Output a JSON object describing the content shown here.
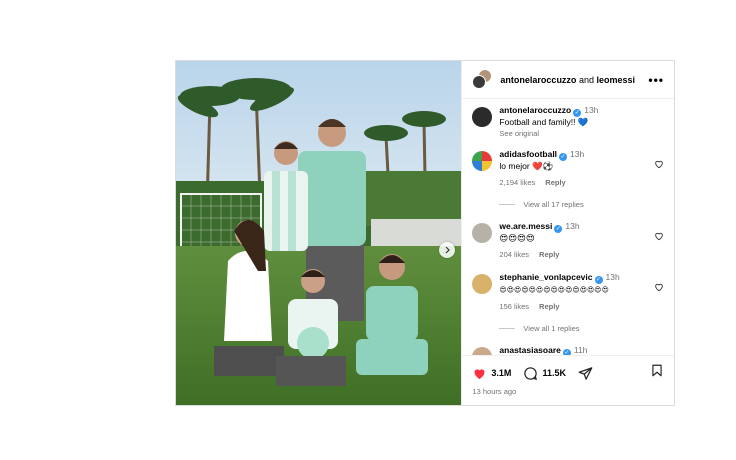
{
  "header": {
    "user1": "antonelaroccuzzo",
    "conj": "and",
    "user2": "leomessi"
  },
  "caption": {
    "username": "antonelaroccuzzo",
    "time": "13h",
    "text": "Football and family!! 💙",
    "see_original": "See original"
  },
  "comments": [
    {
      "username": "adidasfootball",
      "time": "13h",
      "text": "lo mejor ❤️⚽",
      "likes": "2,194 likes",
      "reply": "Reply",
      "view_replies": "View all 17 replies"
    },
    {
      "username": "we.are.messi",
      "time": "13h",
      "text": "😍😍😍😍",
      "likes": "204 likes",
      "reply": "Reply"
    },
    {
      "username": "stephanie_vonlapcevic",
      "time": "13h",
      "text": "😍😍😍😍😍😍😍😍😍😍😍😍😍😍😍",
      "likes": "156 likes",
      "reply": "Reply",
      "view_replies": "View all 1 replies"
    },
    {
      "username": "anastasiasoare",
      "time": "11h"
    }
  ],
  "footer": {
    "likes_count": "3.1M",
    "comments_count": "11.5K",
    "posted_ago": "13 hours ago"
  },
  "colors": {
    "verified": "#3797f0",
    "like_red": "#ff3040",
    "muted_text": "#737373"
  }
}
